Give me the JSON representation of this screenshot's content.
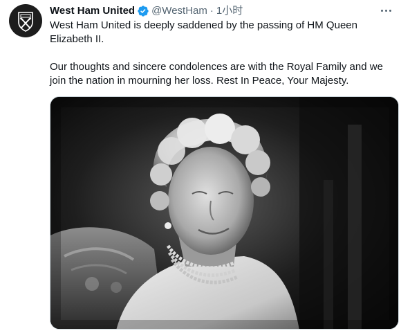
{
  "tweet": {
    "author": {
      "display_name": "West Ham United",
      "handle": "@WestHam",
      "verified": true,
      "avatar_icon": "west-ham-crest-icon"
    },
    "separator": "·",
    "timestamp": "1小时",
    "text": {
      "paragraph_1": "West Ham United is deeply saddened by the passing of HM Queen Elizabeth II.",
      "paragraph_2": "Our thoughts and sincere condolences are with the Royal Family and we join the nation in mourning her loss. Rest In Peace, Your Majesty."
    },
    "media": {
      "type": "photo",
      "description_icon": "black-and-white-portrait-photo"
    }
  },
  "colors": {
    "text_primary": "#0f1419",
    "text_secondary": "#536471",
    "verified_blue": "#1d9bf0",
    "border": "#cfd9de"
  }
}
